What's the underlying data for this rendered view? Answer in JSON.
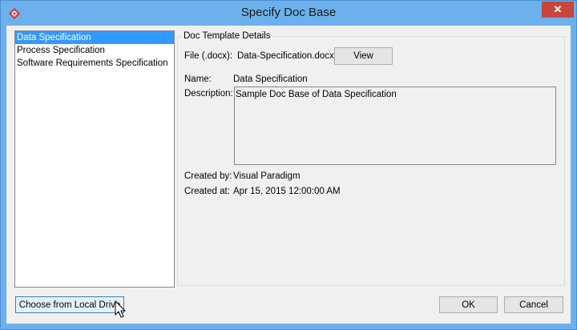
{
  "window": {
    "title": "Specify Doc Base",
    "app_icon": "visual-paradigm-logo-icon",
    "close_icon": "close-icon"
  },
  "doc_list": {
    "items": [
      {
        "label": "Data Specification",
        "selected": true
      },
      {
        "label": "Process Specification",
        "selected": false
      },
      {
        "label": "Software Requirements Specification",
        "selected": false
      }
    ]
  },
  "details": {
    "legend": "Doc Template Details",
    "file_label": "File (.docx):",
    "file_value": "Data-Specification.docx",
    "view_button": "View",
    "name_label": "Name:",
    "name_value": "Data Specification",
    "description_label": "Description:",
    "description_value": "Sample Doc Base of Data Specification",
    "created_by_label": "Created by:",
    "created_by_value": "Visual Paradigm",
    "created_at_label": "Created at:",
    "created_at_value": "Apr 15, 2015 12:00:00 AM"
  },
  "buttons": {
    "choose_local": "Choose from Local Drive",
    "ok": "OK",
    "cancel": "Cancel"
  },
  "colors": {
    "titlebar": "#6cb0ec",
    "close_button": "#c7463d",
    "selection": "#3399ff",
    "dialog_background": "#f0f0f0"
  }
}
